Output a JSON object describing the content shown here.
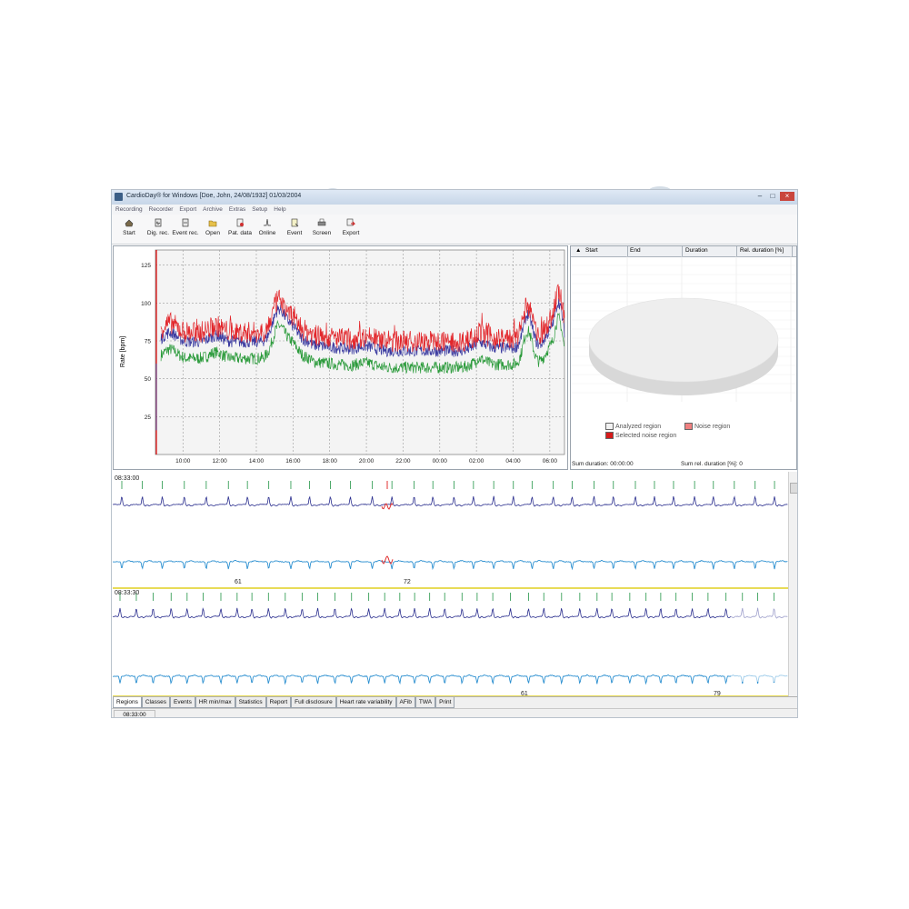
{
  "window": {
    "title": "CardioDay® for Windows [Doe, John, 24/08/1932] 01/03/2004",
    "controls": [
      "–",
      "□",
      "×"
    ]
  },
  "menu": [
    "Recording",
    "Recorder",
    "Export",
    "Archive",
    "Extras",
    "Setup",
    "Help"
  ],
  "toolbar": [
    {
      "label": "Start",
      "icon": "start-icon"
    },
    {
      "label": "Dig. rec.",
      "icon": "digital-recorder-icon"
    },
    {
      "label": "Event rec.",
      "icon": "event-recorder-icon"
    },
    {
      "label": "Open",
      "icon": "open-folder-icon"
    },
    {
      "label": "Pat. data",
      "icon": "patient-data-icon"
    },
    {
      "label": "Online",
      "icon": "online-icon"
    },
    {
      "label": "Event",
      "icon": "event-icon"
    },
    {
      "label": "Screen",
      "icon": "printer-icon"
    },
    {
      "label": "Export",
      "icon": "export-icon"
    }
  ],
  "trend": {
    "ylabel": "Rate [bpm]",
    "y_ticks": [
      "25",
      "50",
      "75",
      "100",
      "125"
    ],
    "x_ticks": [
      "10:00",
      "12:00",
      "14:00",
      "16:00",
      "18:00",
      "20:00",
      "22:00",
      "00:00",
      "02:00",
      "04:00",
      "06:00"
    ],
    "colors": {
      "max": "#e2262b",
      "mean": "#3a3aa0",
      "min": "#2a9a3a",
      "cursor": "#e00000"
    }
  },
  "regions_table": {
    "sort_icon": "▲",
    "columns": [
      "Start",
      "End",
      "Duration",
      "Rel. duration [%]"
    ]
  },
  "legend": {
    "analyzed": "Analyzed region",
    "noise": "Noise region",
    "selected": "Selected noise region",
    "colors": {
      "analyzed": "#f2f2f2",
      "noise": "#f08080",
      "selected": "#d61a1a"
    }
  },
  "summary": {
    "duration": "Sum duration: 00:00:00",
    "rel": "Sum rel. duration [%]: 0"
  },
  "ecg": {
    "strip1_time": "08:33:00",
    "strip2_time": "08:33:30",
    "strip1_labels": [
      "61",
      "72"
    ],
    "strip2_labels": [
      "61",
      "79"
    ],
    "colors": {
      "ch1": "#2a2e8e",
      "ch2": "#2b8fd0",
      "marker": "#3aa05a",
      "separator": "#e5d640",
      "noise": "#e03030"
    }
  },
  "tabs": [
    "Regions",
    "Classes",
    "Events",
    "HR min/max",
    "Statistics",
    "Report",
    "Full disclosure",
    "Heart rate variability",
    "AFib",
    "TWA",
    "Print"
  ],
  "status": {
    "time": "08:33:00"
  }
}
